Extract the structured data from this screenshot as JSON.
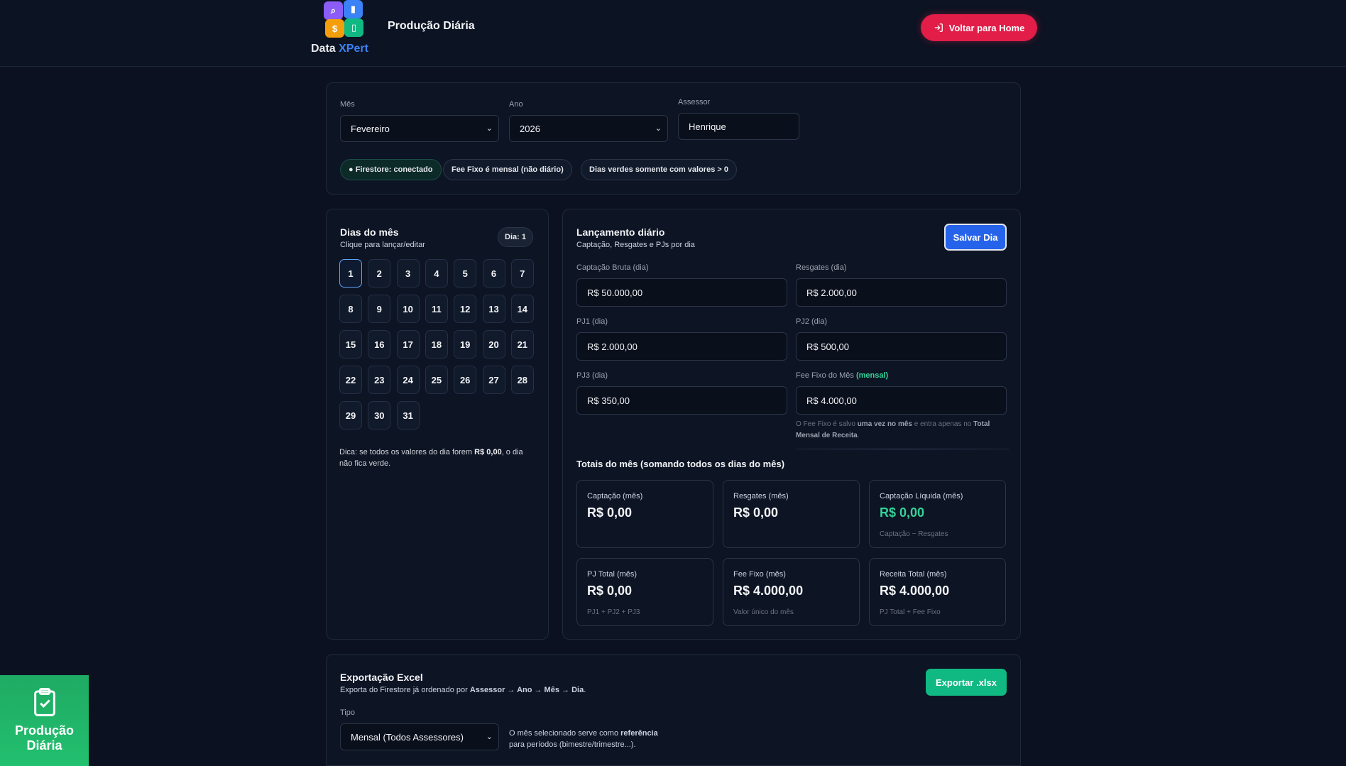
{
  "header": {
    "logo_word1": "Data ",
    "logo_word2": "XPert",
    "title": "Produção Diária",
    "home_button": "Voltar para Home"
  },
  "filters": {
    "month_label": "Mês",
    "month_value": "Fevereiro",
    "year_label": "Ano",
    "year_value": "2026",
    "assessor_label": "Assessor",
    "assessor_value": "Henrique",
    "chips": {
      "firestore": "● Firestore: conectado",
      "fee_prefix": "Fee Fixo é ",
      "fee_bold": "mensal",
      "fee_suffix": " (não diário)",
      "green_prefix": "Dias verdes somente com ",
      "green_bold": "valores > 0"
    }
  },
  "days_panel": {
    "title": "Dias do mês",
    "subtitle": "Clique para lançar/editar",
    "badge": "Dia: 1",
    "days": [
      "1",
      "2",
      "3",
      "4",
      "5",
      "6",
      "7",
      "8",
      "9",
      "10",
      "11",
      "12",
      "13",
      "14",
      "15",
      "16",
      "17",
      "18",
      "19",
      "20",
      "21",
      "22",
      "23",
      "24",
      "25",
      "26",
      "27",
      "28",
      "29",
      "30",
      "31"
    ],
    "selected_day": "1",
    "tip_prefix": "Dica: se todos os valores do dia forem ",
    "tip_bold": "R$ 0,00",
    "tip_suffix": ", o dia não fica verde."
  },
  "entry_panel": {
    "title": "Lançamento diário",
    "subtitle": "Captação, Resgates e PJs por dia",
    "save_button": "Salvar Dia",
    "fields": {
      "captacao_label": "Captação Bruta (dia)",
      "captacao_value": "R$ 50.000,00",
      "resgates_label": "Resgates (dia)",
      "resgates_value": "R$ 2.000,00",
      "pj1_label": "PJ1 (dia)",
      "pj1_value": "R$ 2.000,00",
      "pj2_label": "PJ2 (dia)",
      "pj2_value": "R$ 500,00",
      "pj3_label": "PJ3 (dia)",
      "pj3_value": "R$ 350,00",
      "fee_label": "Fee Fixo do Mês ",
      "fee_label_tag": "(mensal)",
      "fee_value": "R$ 4.000,00"
    },
    "note": {
      "p1": "O Fee Fixo é salvo ",
      "b1": "uma vez no mês",
      "p2": " e entra apenas no ",
      "b2": "Total Mensal de Receita",
      "p3": "."
    },
    "totals_title": "Totais do mês (somando todos os dias do mês)",
    "cards": [
      {
        "title": "Captação (mês)",
        "value": "R$ 0,00",
        "sub": ""
      },
      {
        "title": "Resgates (mês)",
        "value": "R$ 0,00",
        "sub": ""
      },
      {
        "title": "Captação Líquida (mês)",
        "value": "R$ 0,00",
        "sub": "Captação − Resgates"
      },
      {
        "title": "PJ Total (mês)",
        "value": "R$ 0,00",
        "sub": "PJ1 + PJ2 + PJ3"
      },
      {
        "title": "Fee Fixo (mês)",
        "value": "R$ 4.000,00",
        "sub": "Valor único do mês"
      },
      {
        "title": "Receita Total (mês)",
        "value": "R$ 4.000,00",
        "sub": "PJ Total + Fee Fixo"
      }
    ]
  },
  "export_panel": {
    "title": "Exportação Excel",
    "desc_prefix": "Exporta do Firestore já ordenado por ",
    "desc_bold": "Assessor → Ano → Mês → Dia",
    "desc_suffix": ".",
    "button": "Exportar .xlsx",
    "type_label": "Tipo",
    "type_value": "Mensal (Todos Assessores)",
    "hint_prefix": "O mês selecionado serve como ",
    "hint_bold": "referência",
    "hint_suffix": " para períodos (bimestre/trimestre...)."
  },
  "side_tab": {
    "label": "Produção Diária"
  },
  "colors": {
    "background": "#0b1120",
    "accent_red": "#e11d48",
    "accent_blue": "#2563eb",
    "accent_green": "#10b981",
    "positive_text": "#34d399"
  }
}
